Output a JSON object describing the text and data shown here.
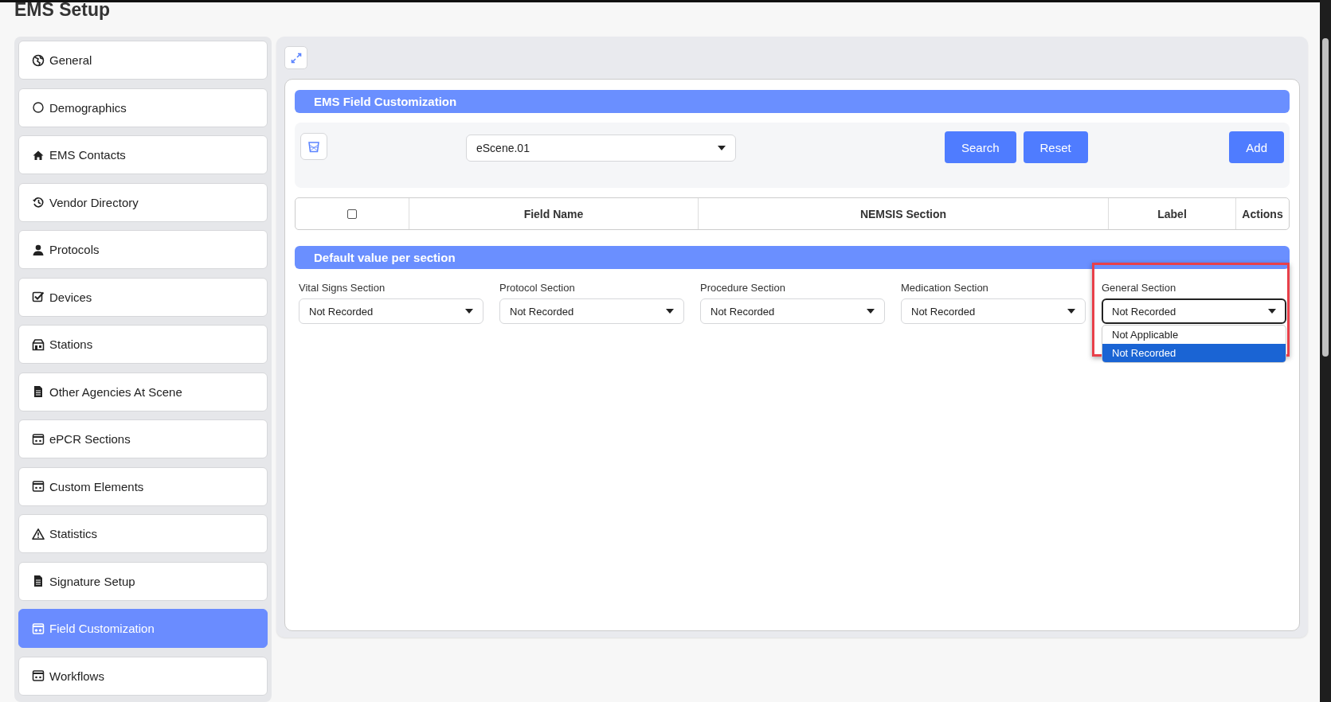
{
  "page_title": "EMS Setup",
  "sidebar": {
    "items": [
      {
        "label": "General",
        "kind": "globe",
        "selected": false
      },
      {
        "label": "Demographics",
        "kind": "circle",
        "selected": false
      },
      {
        "label": "EMS Contacts",
        "kind": "home",
        "selected": false
      },
      {
        "label": "Vendor Directory",
        "kind": "history",
        "selected": false
      },
      {
        "label": "Protocols",
        "kind": "user",
        "selected": false
      },
      {
        "label": "Devices",
        "kind": "checklist",
        "selected": false
      },
      {
        "label": "Stations",
        "kind": "store",
        "selected": false
      },
      {
        "label": "Other Agencies At Scene",
        "kind": "document",
        "selected": false
      },
      {
        "label": "ePCR Sections",
        "kind": "panel",
        "selected": false
      },
      {
        "label": "Custom Elements",
        "kind": "panel",
        "selected": false
      },
      {
        "label": "Statistics",
        "kind": "warning",
        "selected": false
      },
      {
        "label": "Signature Setup",
        "kind": "document",
        "selected": false
      },
      {
        "label": "Field Customization",
        "kind": "panel",
        "selected": true
      },
      {
        "label": "Workflows",
        "kind": "panel",
        "selected": false
      }
    ]
  },
  "customization": {
    "title": "EMS Field Customization",
    "field_select": {
      "value": "eScene.01"
    },
    "buttons": [
      {
        "label": "Search",
        "kind": "action"
      },
      {
        "label": "Reset",
        "kind": "action"
      },
      {
        "label": "Add",
        "kind": "add"
      }
    ],
    "table": {
      "select_all": {
        "checked": false
      },
      "columns": [
        "Field Name",
        "NEMSIS Section",
        "Label",
        "Actions"
      ]
    }
  },
  "defaults": {
    "title": "Default value per section",
    "fields": [
      {
        "label": "Vital Signs Section",
        "value": "Not Recorded",
        "open": false,
        "highlighted": false
      },
      {
        "label": "Protocol Section",
        "value": "Not Recorded",
        "open": false,
        "highlighted": false
      },
      {
        "label": "Procedure Section",
        "value": "Not Recorded",
        "open": false,
        "highlighted": false
      },
      {
        "label": "Medication Section",
        "value": "Not Recorded",
        "open": false,
        "highlighted": false
      },
      {
        "label": "General Section",
        "value": "Not Recorded",
        "open": true,
        "highlighted": true,
        "options": [
          {
            "label": "Not Applicable",
            "selected": false
          },
          {
            "label": "Not Recorded",
            "selected": true
          }
        ]
      }
    ]
  }
}
